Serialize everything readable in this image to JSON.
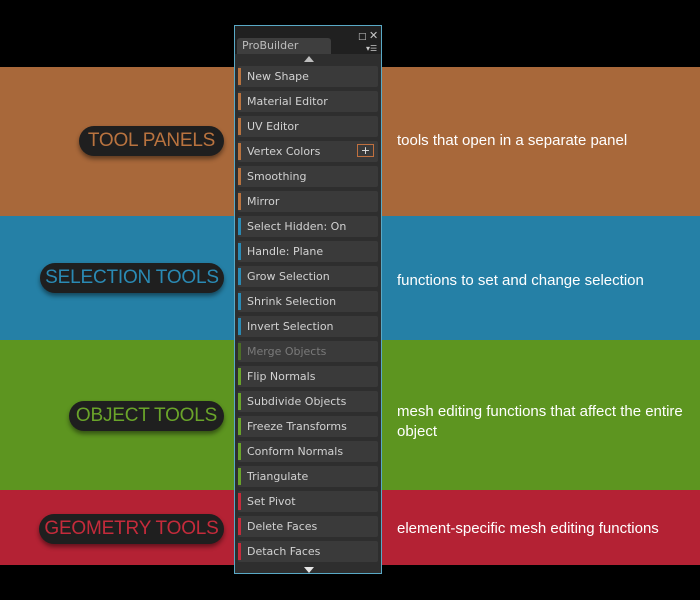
{
  "colors": {
    "tool_panels": "#a8683a",
    "selection": "#2580a6",
    "object": "#5d9520",
    "geometry": "#b42234",
    "panel_border": "#59a9c6"
  },
  "categories": [
    {
      "key": "tool",
      "title": "TOOL PANELS",
      "description": "tools that open in a separate panel"
    },
    {
      "key": "selection",
      "title": "SELECTION TOOLS",
      "description": "functions to set and change selection"
    },
    {
      "key": "object",
      "title": "OBJECT TOOLS",
      "description": "mesh editing functions that affect the entire object"
    },
    {
      "key": "geometry",
      "title": "GEOMETRY TOOLS",
      "description": "element-specific mesh editing functions"
    }
  ],
  "panel": {
    "tab_title": "ProBuilder",
    "icons": {
      "maximize": "maximize-icon",
      "close": "close-icon",
      "menu": "menu-icon",
      "up": "scroll-up-arrow-icon",
      "down": "scroll-down-arrow-icon",
      "plus": "plus-icon"
    },
    "items": [
      {
        "label": "New Shape",
        "group": "tool",
        "color": "#b9733f"
      },
      {
        "label": "Material Editor",
        "group": "tool",
        "color": "#b9733f"
      },
      {
        "label": "UV Editor",
        "group": "tool",
        "color": "#b9733f"
      },
      {
        "label": "Vertex Colors",
        "group": "tool",
        "color": "#b9733f",
        "has_options": true
      },
      {
        "label": "Smoothing",
        "group": "tool",
        "color": "#b9733f"
      },
      {
        "label": "Mirror",
        "group": "tool",
        "color": "#b9733f"
      },
      {
        "label": "Select Hidden: On",
        "group": "selection",
        "color": "#2a8ab4"
      },
      {
        "label": "Handle: Plane",
        "group": "selection",
        "color": "#2a8ab4"
      },
      {
        "label": "Grow Selection",
        "group": "selection",
        "color": "#2a8ab4"
      },
      {
        "label": "Shrink Selection",
        "group": "selection",
        "color": "#2a8ab4"
      },
      {
        "label": "Invert Selection",
        "group": "selection",
        "color": "#2a8ab4"
      },
      {
        "label": "Merge Objects",
        "group": "object",
        "color": "#4c6e26",
        "disabled": true
      },
      {
        "label": "Flip Normals",
        "group": "object",
        "color": "#6aa42a"
      },
      {
        "label": "Subdivide Objects",
        "group": "object",
        "color": "#6aa42a"
      },
      {
        "label": "Freeze Transforms",
        "group": "object",
        "color": "#6aa42a"
      },
      {
        "label": "Conform Normals",
        "group": "object",
        "color": "#6aa42a"
      },
      {
        "label": "Triangulate",
        "group": "object",
        "color": "#6aa42a"
      },
      {
        "label": "Set Pivot",
        "group": "geometry",
        "color": "#c52b3b"
      },
      {
        "label": "Delete Faces",
        "group": "geometry",
        "color": "#c52b3b"
      },
      {
        "label": "Detach Faces",
        "group": "geometry",
        "color": "#c52b3b"
      }
    ]
  }
}
